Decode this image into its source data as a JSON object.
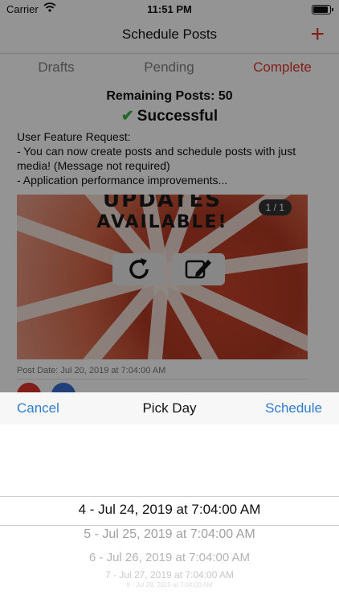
{
  "status_bar": {
    "carrier": "Carrier",
    "time": "11:51 PM"
  },
  "nav": {
    "title": "Schedule Posts",
    "add_icon": "plus-icon"
  },
  "tabs": [
    {
      "label": "Drafts"
    },
    {
      "label": "Pending"
    },
    {
      "label": "Complete",
      "active": true
    }
  ],
  "summary": {
    "remaining": "Remaining Posts: 50",
    "status": "Successful"
  },
  "post": {
    "text": "User Feature Request:\n- You can now create posts and schedule posts with just media! (Message not required)\n- Application performance improvements...",
    "image_headline_1": "UPDATES",
    "image_headline_2": "AVAILABLE!",
    "image_counter": "1 / 1",
    "date": "Post Date: Jul 20, 2019 at 7:04:00 AM"
  },
  "picker_sheet": {
    "cancel_label": "Cancel",
    "title": "Pick Day",
    "schedule_label": "Schedule",
    "selected": "4 - Jul 24, 2019 at 7:04:00 AM",
    "options_below": [
      "5 - Jul 25, 2019 at 7:04:00 AM",
      "6 - Jul 26, 2019 at 7:04:00 AM",
      "7 - Jul 27, 2019 at 7:04:00 AM",
      "8 - Jul 28, 2019 at 7:04:00 AM"
    ]
  },
  "colors": {
    "accent_red": "#e0352c",
    "link_blue": "#2f7ccd",
    "success_green": "#39b54a"
  }
}
